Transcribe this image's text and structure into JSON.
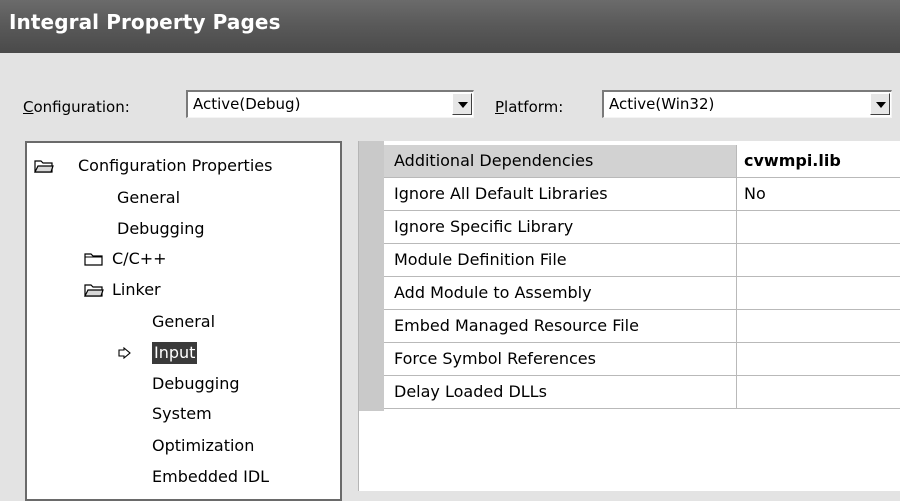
{
  "window": {
    "title": "Integral Property Pages"
  },
  "config_bar": {
    "configuration": {
      "label_key": "C",
      "label_rest": "onfiguration:",
      "value": "Active(Debug)"
    },
    "platform": {
      "label_key": "P",
      "label_rest": "latform:",
      "value": "Active(Win32)"
    }
  },
  "tree": {
    "root": {
      "label": "Configuration Properties",
      "icon": "open-folder-icon"
    },
    "general": "General",
    "debugging": "Debugging",
    "cpp": {
      "label": "C/C++",
      "icon": "closed-folder-icon"
    },
    "linker": {
      "label": "Linker",
      "icon": "open-folder-icon"
    },
    "linker_general": "General",
    "linker_input": {
      "label": "Input",
      "selected": true,
      "marker": "caret-right-icon"
    },
    "linker_debugging": "Debugging",
    "linker_system": "System",
    "linker_optimization": "Optimization",
    "linker_embedded_idl": "Embedded IDL"
  },
  "properties": [
    {
      "name": "Additional Dependencies",
      "value": "cvwmpi.lib"
    },
    {
      "name": "Ignore All Default Libraries",
      "value": "No"
    },
    {
      "name": "Ignore Specific Library",
      "value": ""
    },
    {
      "name": "Module Definition File",
      "value": ""
    },
    {
      "name": "Add Module to Assembly",
      "value": ""
    },
    {
      "name": "Embed Managed Resource File",
      "value": ""
    },
    {
      "name": "Force Symbol References",
      "value": ""
    },
    {
      "name": "Delay Loaded DLLs",
      "value": ""
    }
  ],
  "colors": {
    "titlebar": "#5a5a5a",
    "dialog": "#e3e3e3",
    "selection": "#3a3a3a",
    "gutter": "#c9c9c9"
  }
}
